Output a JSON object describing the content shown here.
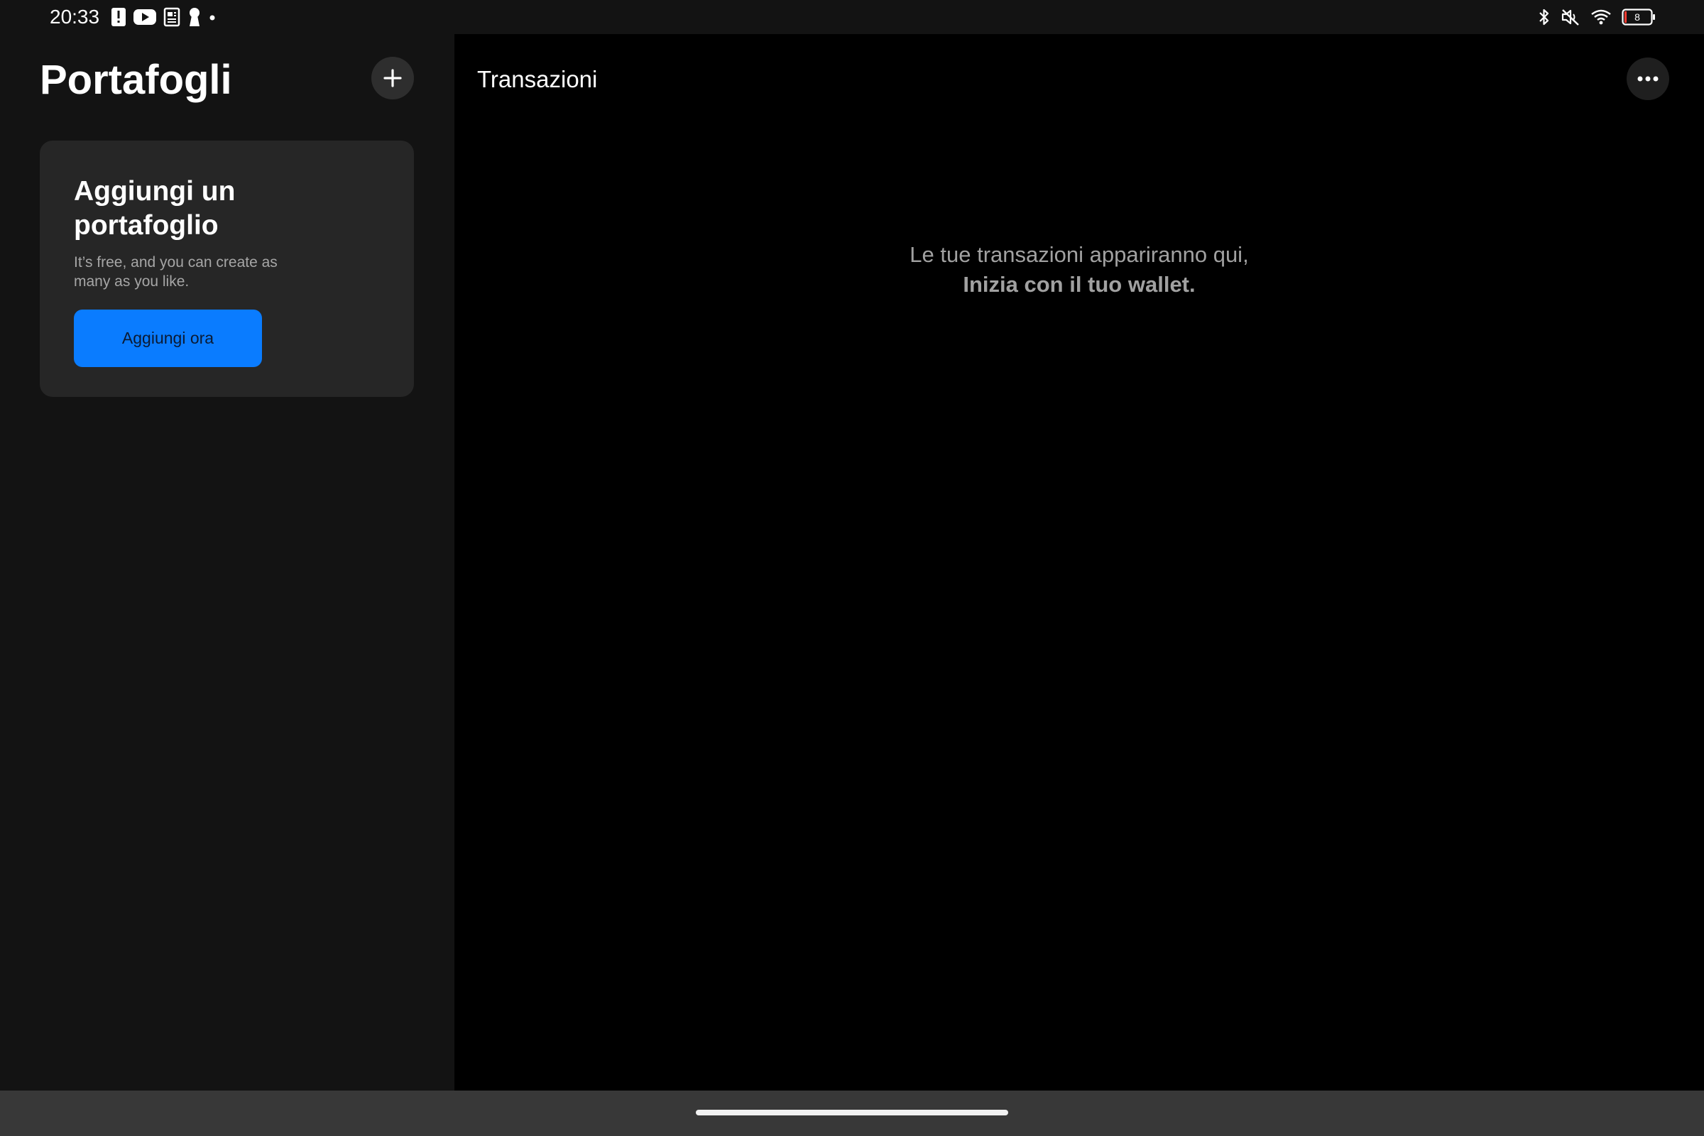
{
  "status_bar": {
    "time": "20:33",
    "left_icons": [
      "alert-icon",
      "youtube-icon",
      "document-icon",
      "keyhole-icon",
      "dot-icon"
    ],
    "right_icons": [
      "bluetooth-icon",
      "mute-icon",
      "wifi-icon",
      "battery-icon"
    ],
    "battery_level": "8",
    "battery_color": "#ff3b30"
  },
  "left_pane": {
    "title": "Portafogli",
    "add_icon": "plus-icon",
    "card": {
      "title": "Aggiungi un portafoglio",
      "subtitle": "It’s free, and you can create as many as you like.",
      "button_label": "Aggiungi ora"
    }
  },
  "right_pane": {
    "title": "Transazioni",
    "more_icon": "more-icon",
    "empty_line_1": "Le tue transazioni appariranno qui,",
    "empty_line_2": "Inizia con il tuo wallet."
  },
  "colors": {
    "accent": "#0a7cff",
    "pane_left_bg": "#131313",
    "card_bg": "#262626",
    "right_bg": "#000000"
  }
}
